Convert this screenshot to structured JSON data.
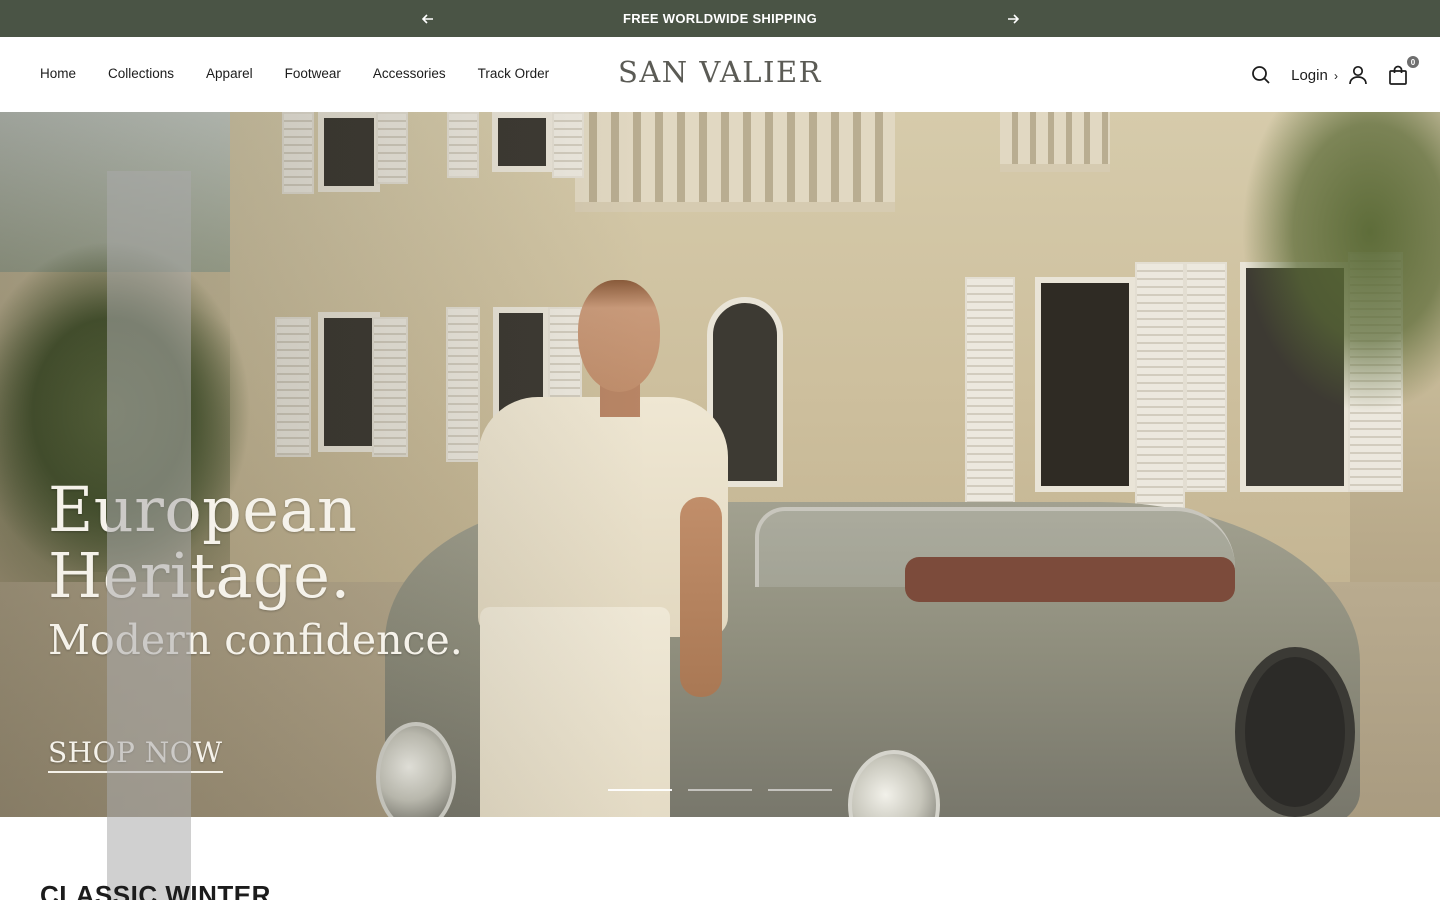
{
  "announcement": {
    "message": "FREE WORLDWIDE SHIPPING",
    "prev_icon": "arrow-left-icon",
    "next_icon": "arrow-right-icon",
    "background": "#4a5445"
  },
  "header": {
    "logo": "SAN VALIER",
    "nav": [
      "Home",
      "Collections",
      "Apparel",
      "Footwear",
      "Accessories",
      "Track Order"
    ],
    "login_label": "Login",
    "login_chevron": "›",
    "cart_count": "0",
    "icons": [
      "search-icon",
      "account-icon",
      "cart-icon"
    ]
  },
  "hero": {
    "heading_line1": "European",
    "heading_line2": "Heritage.",
    "subheading": "Modern confidence.",
    "cta": "SHOP NOW",
    "slides": 3,
    "active_slide": 1
  },
  "section": {
    "title": "CLASSIC WINTER"
  }
}
